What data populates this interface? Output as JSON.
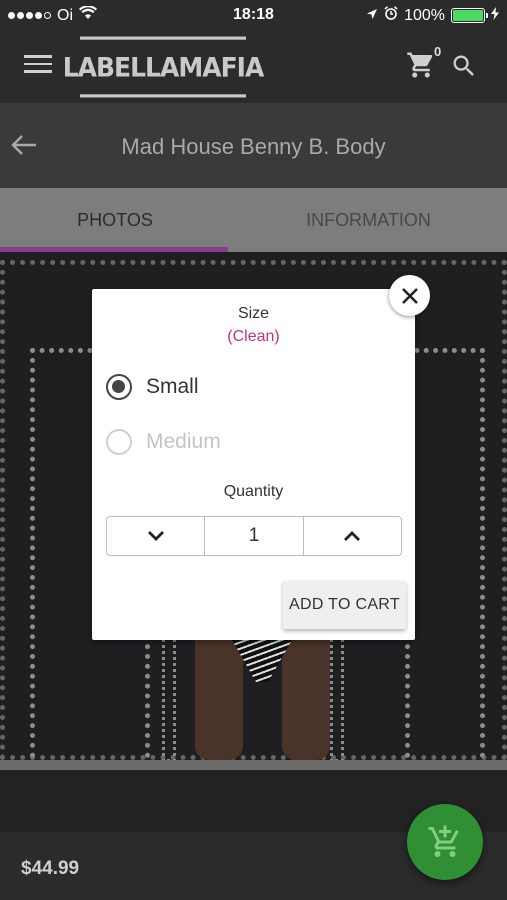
{
  "status_bar": {
    "carrier": "Oi",
    "time": "18:18",
    "battery": "100%",
    "battery_level": 1.0
  },
  "header": {
    "logo_text": "LABELLAMAFIA",
    "cart_count": "0",
    "icons": [
      "menu-icon",
      "cart-icon",
      "search-icon"
    ]
  },
  "product": {
    "title": "Mad House Benny B. Body",
    "price": "$44.99"
  },
  "tabs": [
    {
      "label": "PHOTOS",
      "active": true
    },
    {
      "label": "INFORMATION",
      "active": false
    }
  ],
  "dialog": {
    "size_label": "Size",
    "size_variant": "(Clean)",
    "options": [
      {
        "label": "Small",
        "selected": true,
        "disabled": false
      },
      {
        "label": "Medium",
        "selected": false,
        "disabled": true
      }
    ],
    "quantity_label": "Quantity",
    "quantity_value": "1",
    "add_to_cart_label": "ADD TO CART"
  },
  "colors": {
    "accent_tab": "#8a3c8c",
    "variant_text": "#c0347a",
    "fab": "#2f8f32"
  }
}
